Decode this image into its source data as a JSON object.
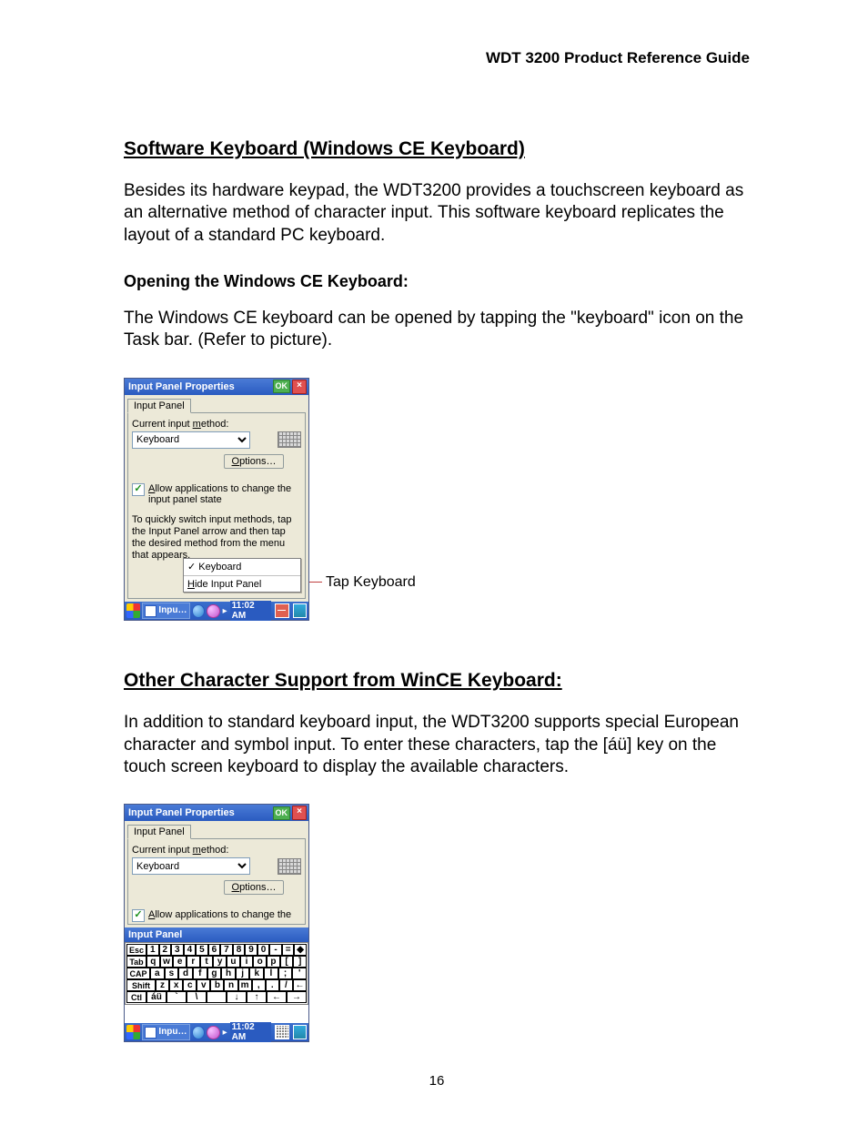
{
  "running_head": "WDT 3200 Product Reference Guide",
  "section1": {
    "title": "Software Keyboard (Windows CE Keyboard)",
    "para": "Besides its hardware keypad, the WDT3200 provides a touchscreen keyboard as an alternative method of character input.   This software keyboard replicates the layout of a standard PC keyboard.",
    "sub": "Opening the Windows CE Keyboard:",
    "para2": "The Windows CE keyboard can be opened by tapping the \"keyboard\" icon on the Task bar. (Refer to picture)."
  },
  "fig1": {
    "title": "Input Panel Properties",
    "ok": "OK",
    "tab": "Input Panel",
    "lbl_method": "Current input method:",
    "combo": "Keyboard",
    "options": "Options…",
    "chk": "Allow applications to change the input panel state",
    "hint": "To quickly switch input methods, tap the Input Panel arrow and then tap the desired method from the menu that appears.",
    "popup_keyboard": "Keyboard",
    "popup_hide": "Hide Input Panel",
    "task_app": "Inpu…",
    "time": "11:02 AM",
    "callout": "Tap Keyboard"
  },
  "section2": {
    "title": "Other Character Support from WinCE Keyboard:",
    "para": "In addition to standard keyboard input, the WDT3200 supports special European character and symbol input.   To enter these characters, tap the [áü] key on the touch screen keyboard to display the available characters."
  },
  "fig2": {
    "title": "Input Panel Properties",
    "ok": "OK",
    "tab": "Input Panel",
    "lbl_method": "Current input method:",
    "combo": "Keyboard",
    "options": "Options…",
    "chk": "Allow applications to change the",
    "osk_title": "Input Panel",
    "row1": [
      "Esc",
      "1",
      "2",
      "3",
      "4",
      "5",
      "6",
      "7",
      "8",
      "9",
      "0",
      "-",
      "=",
      "◆"
    ],
    "row2": [
      "Tab",
      "q",
      "w",
      "e",
      "r",
      "t",
      "y",
      "u",
      "i",
      "o",
      "p",
      "[",
      "]"
    ],
    "row3": [
      "CAP",
      "a",
      "s",
      "d",
      "f",
      "g",
      "h",
      "j",
      "k",
      "l",
      ";",
      "'"
    ],
    "row4": [
      "Shift",
      "z",
      "x",
      "c",
      "v",
      "b",
      "n",
      "m",
      ",",
      ".",
      "/",
      "←"
    ],
    "row5": [
      "Ctl",
      "áü",
      "`",
      "\\",
      " ",
      "↓",
      "↑",
      "←",
      "→"
    ],
    "task_app": "Inpu…",
    "time": "11:02 AM"
  },
  "page_num": "16"
}
